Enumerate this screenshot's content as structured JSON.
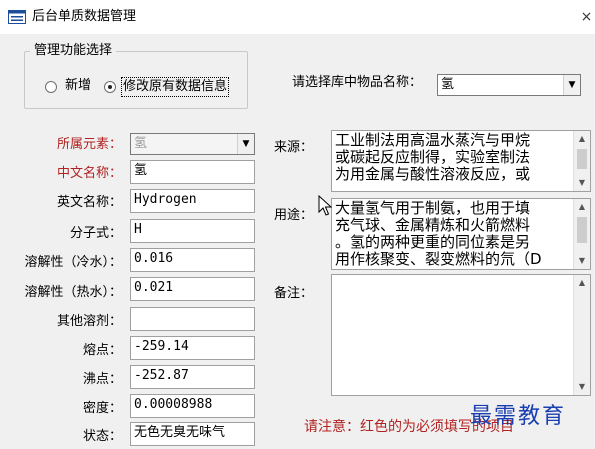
{
  "window": {
    "title": "后台单质数据管理",
    "close_glyph": "×"
  },
  "mode_group": {
    "legend": "管理功能选择",
    "options": [
      {
        "label": "新增",
        "checked": false
      },
      {
        "label": "修改原有数据信息",
        "checked": true
      }
    ]
  },
  "item_select": {
    "label": "请选择库中物品名称：",
    "value": "氢"
  },
  "form": {
    "element": {
      "label": "所属元素：",
      "value": "氢",
      "required": true
    },
    "chinese_name": {
      "label": "中文名称：",
      "value": "氢",
      "required": true
    },
    "english_name": {
      "label": "英文名称：",
      "value": "Hydrogen"
    },
    "formula": {
      "label": "分子式：",
      "value": "H"
    },
    "solubility_cold": {
      "label": "溶解性（冷水）：",
      "value": "0.016"
    },
    "solubility_hot": {
      "label": "溶解性（热水）：",
      "value": "0.021"
    },
    "other_solvents": {
      "label": "其他溶剂：",
      "value": ""
    },
    "melting_point": {
      "label": "熔点：",
      "value": "-259.14"
    },
    "boiling_point": {
      "label": "沸点：",
      "value": "-252.87"
    },
    "density": {
      "label": "密度：",
      "value": "0.00008988"
    },
    "state": {
      "label": "状态：",
      "value": "无色无臭无味气"
    }
  },
  "source": {
    "label": "来源：",
    "lines": [
      "工业制法用高温水蒸汽与甲烷",
      "或碳起反应制得，实验室制法",
      "为用金属与酸性溶液反应，或"
    ]
  },
  "usage": {
    "label": "用途：",
    "lines": [
      "大量氢气用于制氨，也用于填",
      "充气球、金属精炼和火箭燃料",
      "。氢的两种更重的同位素是另",
      "用作核聚变、裂变燃料的氘（D"
    ]
  },
  "remarks": {
    "label": "备注：",
    "value": ""
  },
  "note": "请注意：红色的为必须填写的项目",
  "watermark": "最需教育",
  "colors": {
    "required": "#b22222",
    "watermark": "#1a3fb0"
  }
}
